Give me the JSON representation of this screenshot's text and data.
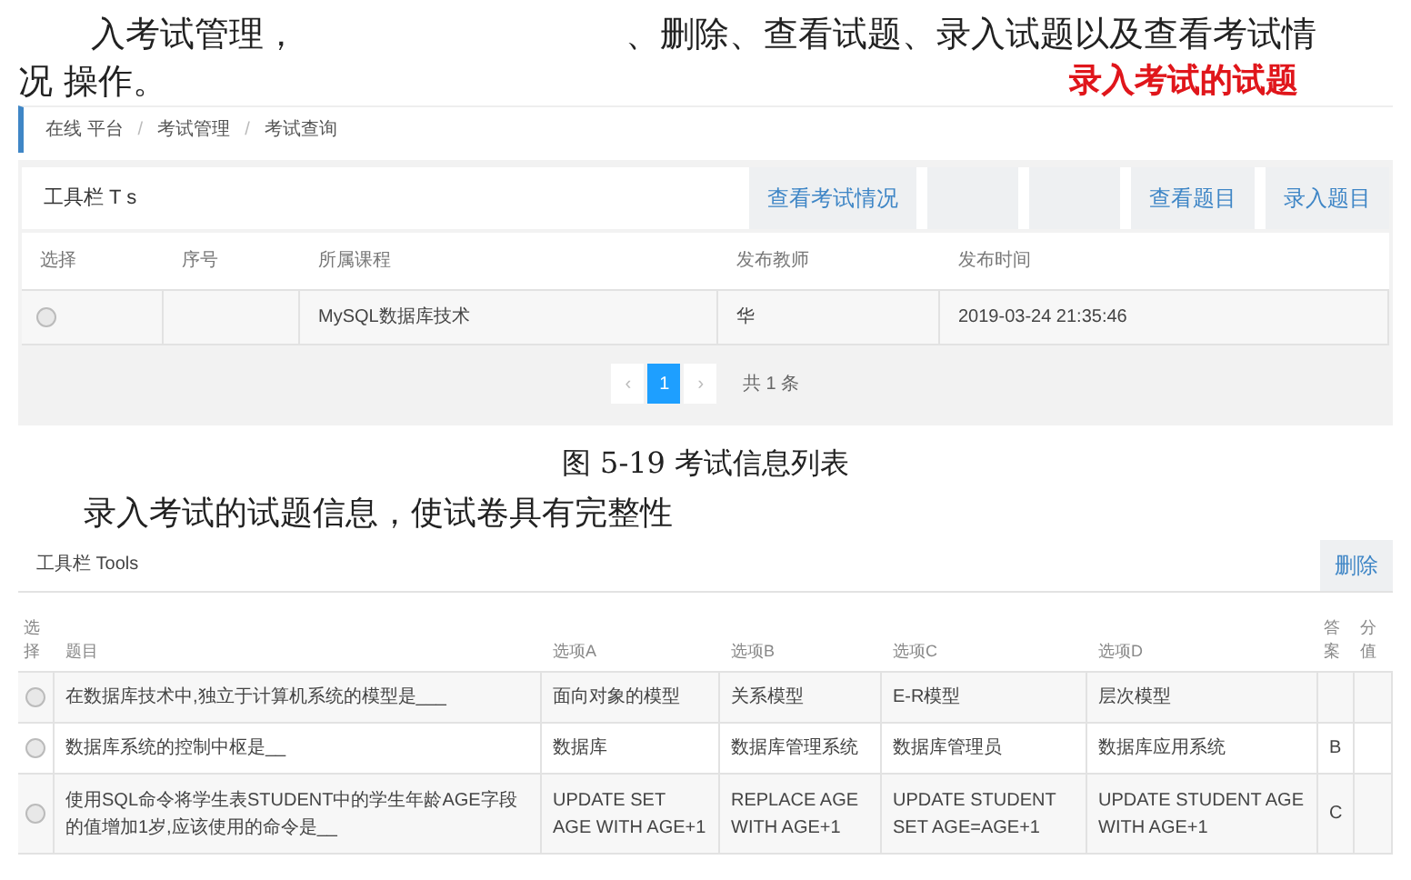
{
  "intro": {
    "line_1": "入考试管理，",
    "line_1_end": "、删除、查看试题、录入试题以及查看考试情",
    "line_2": "况 操作。"
  },
  "annotation": "录入考试的试题",
  "breadcrumb": {
    "separator": "/",
    "items": [
      "在线 平台",
      "考试管理",
      "考试查询"
    ]
  },
  "exam_panel": {
    "toolbar_label": "工具栏 T s",
    "buttons": [
      {
        "kind": "text",
        "label": "查看考试情况"
      },
      {
        "kind": "blank"
      },
      {
        "kind": "blank"
      },
      {
        "kind": "text",
        "label": "查看题目"
      },
      {
        "kind": "text",
        "label": "录入题目"
      }
    ],
    "columns": [
      "选择",
      "序号",
      "所属课程",
      "发布教师",
      "发布时间"
    ],
    "rows": [
      {
        "selected": false,
        "cells": [
          "",
          "",
          "MySQL数据库技术",
          "华",
          "2019-03-24 21:35:46"
        ]
      }
    ],
    "pagination": {
      "prev": "‹",
      "pages": [
        {
          "label": "1",
          "selected": true
        }
      ],
      "next": "›",
      "total": "共 1 条"
    }
  },
  "caption_1": "图 5-19   考试信息列表",
  "paragraph": "录入考试的试题信息，使试卷具有完整性",
  "question_panel": {
    "toolbar_label": "工具栏 Tools",
    "delete_button": "删除",
    "columns": [
      "选择",
      "题目",
      "选项A",
      "选项B",
      "选项C",
      "选项D",
      "答案",
      "分值"
    ],
    "rows": [
      {
        "selected": false,
        "cells": [
          "",
          "在数据库技术中,独立于计算机系统的模型是___",
          "面向对象的模型",
          "关系模型",
          "E-R模型",
          "层次模型",
          "",
          ""
        ]
      },
      {
        "selected": false,
        "cells": [
          "",
          "数据库系统的控制中枢是__",
          "数据库",
          "数据库管理系统",
          "数据库管理员",
          "数据库应用系统",
          "B",
          ""
        ]
      },
      {
        "selected": false,
        "cells": [
          "",
          "使用SQL命令将学生表STUDENT中的学生年龄AGE字段的值增加1岁,应该使用的命令是__",
          "UPDATE SET AGE WITH AGE+1",
          "REPLACE AGE WITH AGE+1",
          "UPDATE STUDENT SET AGE=AGE+1",
          "UPDATE STUDENT AGE WITH AGE+1",
          "C",
          ""
        ]
      }
    ]
  }
}
